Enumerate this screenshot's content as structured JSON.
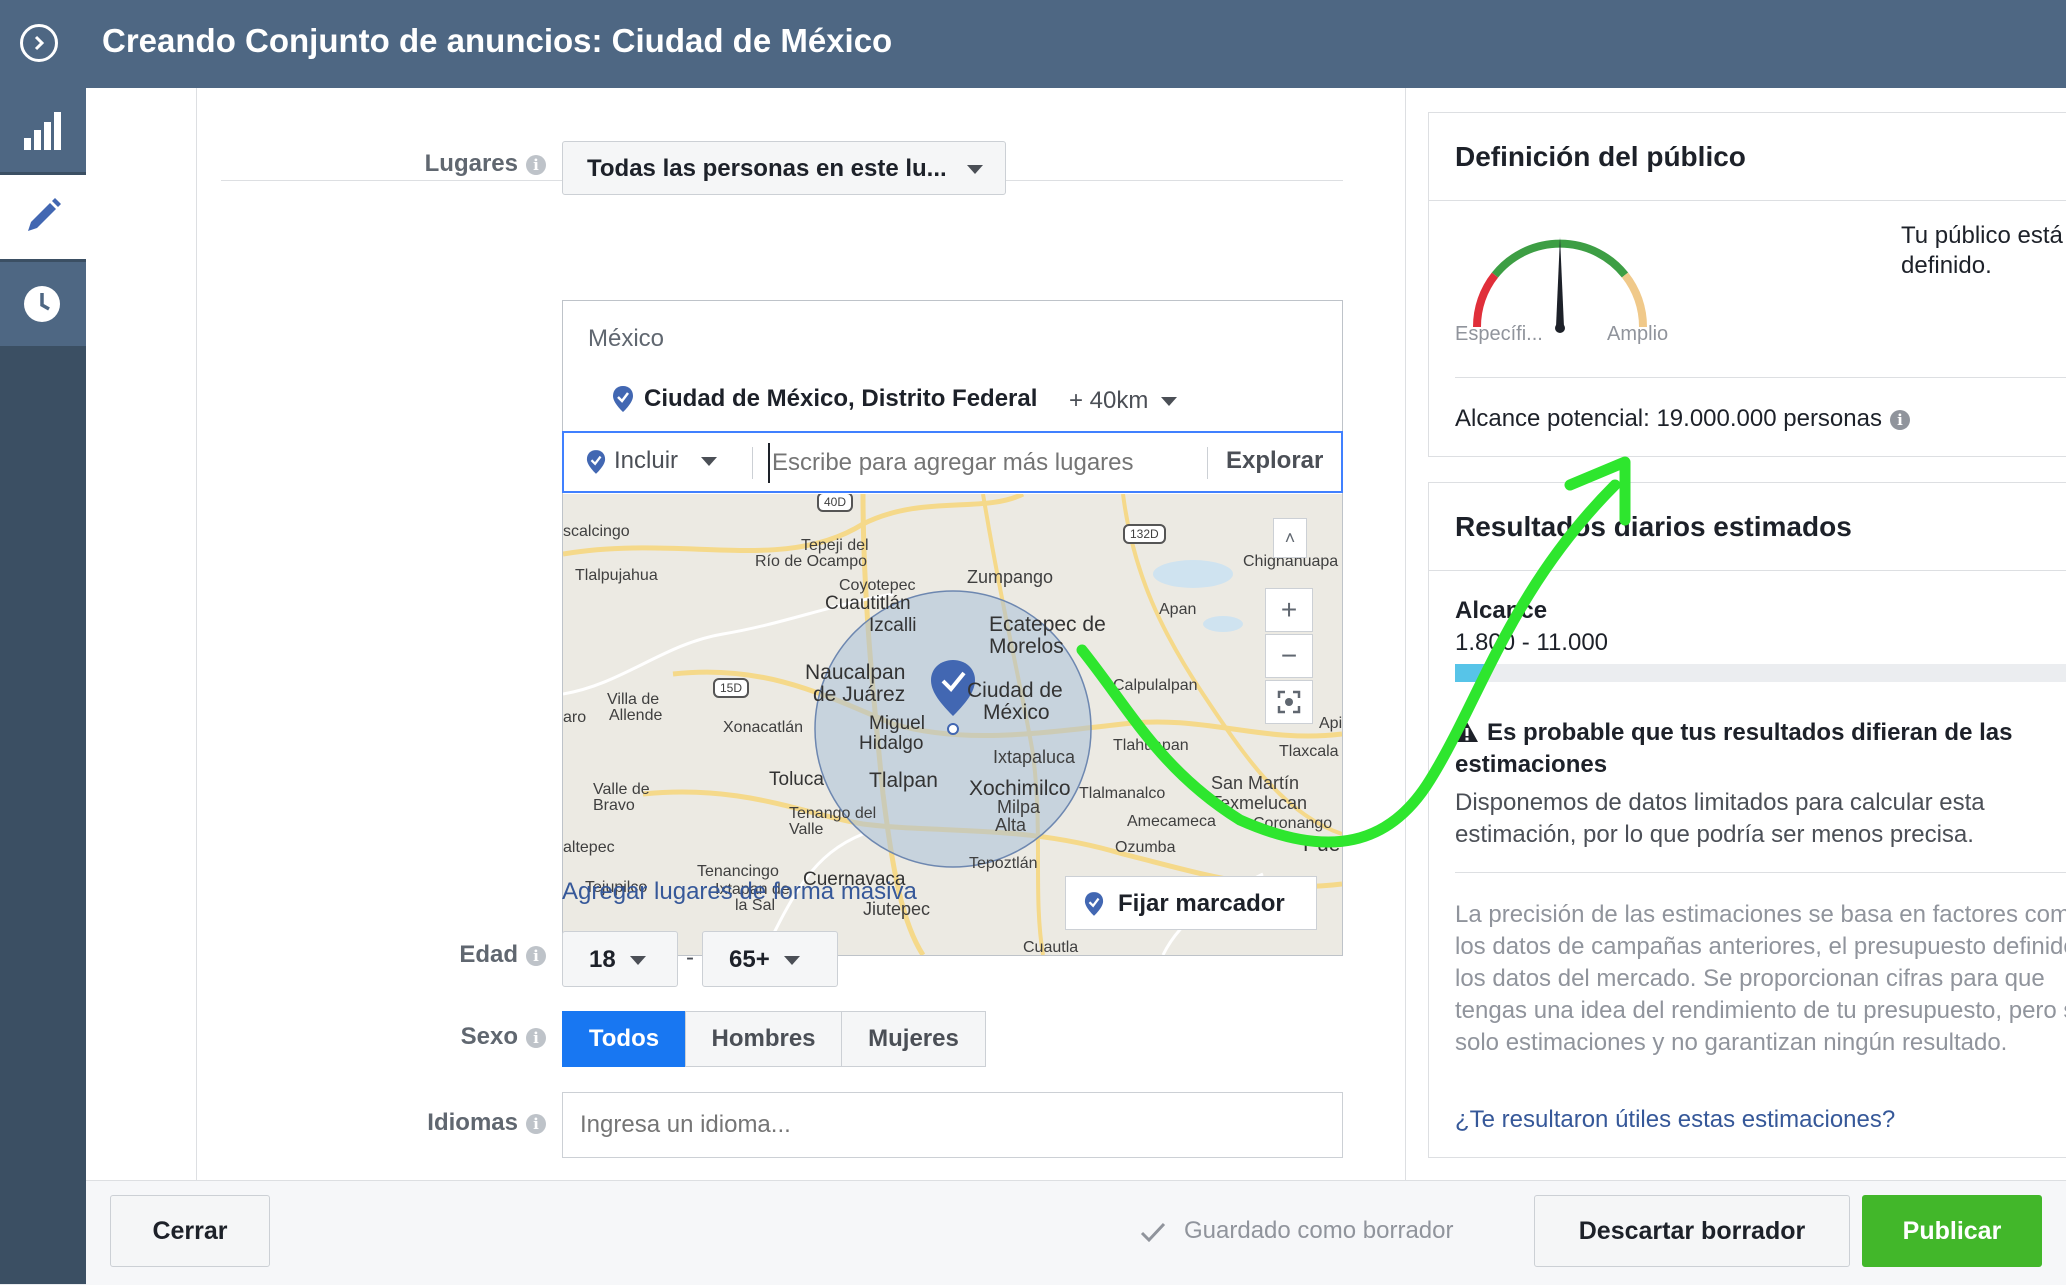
{
  "header": {
    "title": "Creando Conjunto de anuncios: Ciudad de México"
  },
  "sidebar": {
    "items": [
      {
        "icon": "bar-chart-icon"
      },
      {
        "icon": "pencil-icon"
      },
      {
        "icon": "clock-icon"
      }
    ]
  },
  "form": {
    "places": {
      "label": "Lugares",
      "selected": "Todas las personas en este lu...",
      "country": "México",
      "location": "Ciudad de México, Distrito Federal",
      "radius": "+ 40km",
      "include_label": "Incluir",
      "input_placeholder": "Escribe para agregar más lugares",
      "explore_label": "Explorar",
      "pin_button": "Fijar marcador",
      "bulk_link": "Agregar lugares de forma masiva"
    },
    "map": {
      "labels": [
        "scalcingo",
        "Tepeji del",
        "Río de Ocampo",
        "Tlalpujahua",
        "Zumpango",
        "Coyotepec",
        "Cuautitlán",
        "Izcalli",
        "Ecatepec de",
        "Morelos",
        "Apan",
        "Chignahuapa",
        "Naucalpan",
        "de Juárez",
        "Ciudad de",
        "México",
        "Miguel",
        "Hidalgo",
        "Villa de",
        "aro",
        "Allende",
        "Xonacatlán",
        "Calpulalpan",
        "Ixtapaluca",
        "Api",
        "Tlahuapan",
        "Tlaxcala",
        "Toluca",
        "Tlalpan",
        "Xochimilco",
        "Milpa",
        "Alta",
        "Tlalmanalco",
        "San Martín",
        "Texmelucan",
        "Valle de",
        "Bravo",
        "Tenango del",
        "Valle",
        "Amecameca",
        "Coronango",
        "altepec",
        "Ozumba",
        "Pue",
        "Tenancingo",
        "Tepoztlán",
        "Tejupilco",
        "Ixtapan de",
        "la Sal",
        "Cuernavaca",
        "Jiutepec",
        "Cuautla"
      ],
      "shields": [
        "40D",
        "132D",
        "15D"
      ]
    },
    "age": {
      "label": "Edad",
      "min": "18",
      "separator": "-",
      "max": "65+"
    },
    "gender": {
      "label": "Sexo",
      "options": [
        "Todos",
        "Hombres",
        "Mujeres"
      ]
    },
    "languages": {
      "label": "Idiomas",
      "placeholder": "Ingresa un idioma..."
    }
  },
  "audience": {
    "title": "Definición del público",
    "status": "Tu público está definido.",
    "gauge_left": "Específi...",
    "gauge_right": "Amplio",
    "gauge_level": 0.5,
    "reach": "Alcance potencial: 19.000.000 personas"
  },
  "results": {
    "title": "Resultados diarios estimados",
    "reach_label": "Alcance",
    "reach_value": "1.800 - 11.000",
    "reach_fill": 0.05,
    "warning_title": "Es probable que tus resultados difieran de las estimaciones",
    "warning_body": "Disponemos de datos limitados para calcular esta estimación, por lo que podría ser menos precisa.",
    "note": "La precisión de las estimaciones se basa en factores como los datos de campañas anteriores, el presupuesto definido y los datos del mercado. Se proporcionan cifras para que tengas una idea del rendimiento de tu presupuesto, pero son solo estimaciones y no garantizan ningún resultado.",
    "feedback_link": "¿Te resultaron útiles estas estimaciones?"
  },
  "footer": {
    "close": "Cerrar",
    "saved": "Guardado como borrador",
    "discard": "Descartar borrador",
    "publish": "Publicar"
  },
  "colors": {
    "header": "#4e6783",
    "sidebar": "#3b4f63",
    "primary": "#1877f2",
    "publish": "#42b72a",
    "link": "#365899",
    "annotation": "#2ee62e"
  }
}
